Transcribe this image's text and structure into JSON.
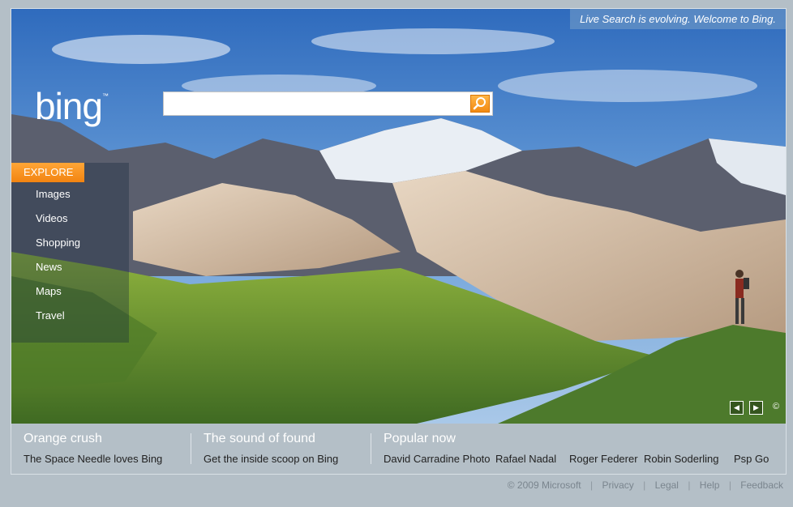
{
  "welcome_text": "Live Search is evolving. Welcome to Bing.",
  "logo": {
    "text": "bing",
    "tm": "™"
  },
  "search": {
    "value": "",
    "placeholder": ""
  },
  "explore": {
    "label": "EXPLORE",
    "items": [
      "Images",
      "Videos",
      "Shopping",
      "News",
      "Maps",
      "Travel"
    ]
  },
  "controls": {
    "prev": "◀",
    "next": "▶",
    "copyright": "©"
  },
  "bottom": {
    "col1": {
      "title": "Orange crush",
      "link": "The Space Needle loves Bing"
    },
    "col2": {
      "title": "The sound of found",
      "link": "Get the inside scoop on Bing"
    },
    "col3": {
      "title": "Popular now",
      "links": [
        "David Carradine Photo",
        "Rafael Nadal",
        "Roger Federer",
        "Robin Soderling",
        "Psp Go"
      ]
    }
  },
  "footer": {
    "copyright": "© 2009 Microsoft",
    "links": [
      "Privacy",
      "Legal",
      "Help",
      "Feedback"
    ]
  },
  "colors": {
    "accent": "#f28a12",
    "sky": "#3f77c4",
    "grass": "#6d9a2e"
  }
}
